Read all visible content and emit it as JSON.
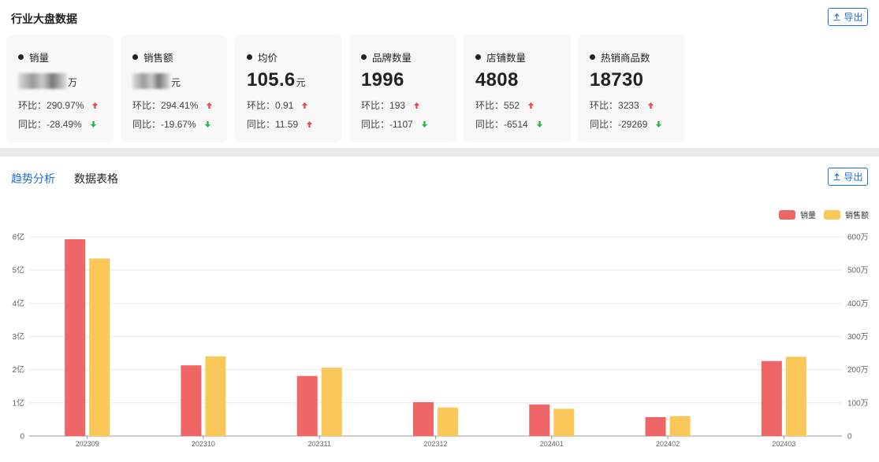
{
  "overview": {
    "title": "行业大盘数据",
    "export_label": "导出",
    "cards": [
      {
        "title": "销量",
        "value": "3",
        "value_blurred": true,
        "unit": "万",
        "mom_label": "环比：",
        "mom": "290.97%",
        "mom_dir": "up",
        "yoy_label": "同比：",
        "yoy": "-28.49%",
        "yoy_dir": "down"
      },
      {
        "title": "销售额",
        "value": "3.4",
        "value_blurred": true,
        "unit": "元",
        "mom_label": "环比：",
        "mom": "294.41%",
        "mom_dir": "up",
        "yoy_label": "同比：",
        "yoy": "-19.67%",
        "yoy_dir": "down"
      },
      {
        "title": "均价",
        "value": "105.6",
        "value_blurred": false,
        "unit": "元",
        "mom_label": "环比：",
        "mom": "0.91",
        "mom_dir": "up",
        "yoy_label": "同比：",
        "yoy": "11.59",
        "yoy_dir": "up"
      },
      {
        "title": "品牌数量",
        "value": "1996",
        "value_blurred": false,
        "unit": "",
        "mom_label": "环比：",
        "mom": "193",
        "mom_dir": "up",
        "yoy_label": "同比：",
        "yoy": "-1107",
        "yoy_dir": "down"
      },
      {
        "title": "店铺数量",
        "value": "4808",
        "value_blurred": false,
        "unit": "",
        "mom_label": "环比：",
        "mom": "552",
        "mom_dir": "up",
        "yoy_label": "同比：",
        "yoy": "-6514",
        "yoy_dir": "down"
      },
      {
        "title": "热销商品数",
        "value": "18730",
        "value_blurred": false,
        "unit": "",
        "mom_label": "环比：",
        "mom": "3233",
        "mom_dir": "up",
        "yoy_label": "同比：",
        "yoy": "-29269",
        "yoy_dir": "down"
      }
    ]
  },
  "analysis": {
    "tabs": [
      {
        "label": "趋势分析",
        "active": true
      },
      {
        "label": "数据表格",
        "active": false
      }
    ],
    "export_label": "导出"
  },
  "colors": {
    "up": "#f0454c",
    "down": "#22b84a",
    "sales": "#ee6666",
    "revenue": "#fac858",
    "accent": "#1d6fd8"
  },
  "chart_data": {
    "type": "bar",
    "categories": [
      "202309",
      "202310",
      "202311",
      "202312",
      "202401",
      "202402",
      "202403"
    ],
    "series": [
      {
        "name": "销量",
        "axis": "left",
        "values": [
          5.93,
          2.13,
          1.81,
          1.02,
          0.95,
          0.57,
          2.26
        ],
        "color": "#ee6666"
      },
      {
        "name": "销售额",
        "axis": "right",
        "values": [
          535,
          240,
          206,
          86,
          82,
          60,
          239
        ],
        "color": "#fac858"
      }
    ],
    "y_left": {
      "ticks": [
        "0",
        "1亿",
        "2亿",
        "3亿",
        "4亿",
        "5亿",
        "6亿"
      ],
      "ylim": [
        0,
        6
      ]
    },
    "y_right": {
      "ticks": [
        "0",
        "100万",
        "200万",
        "300万",
        "400万",
        "500万",
        "600万"
      ],
      "ylim": [
        0,
        600
      ]
    },
    "legend_position": "top-right",
    "grid": true
  }
}
